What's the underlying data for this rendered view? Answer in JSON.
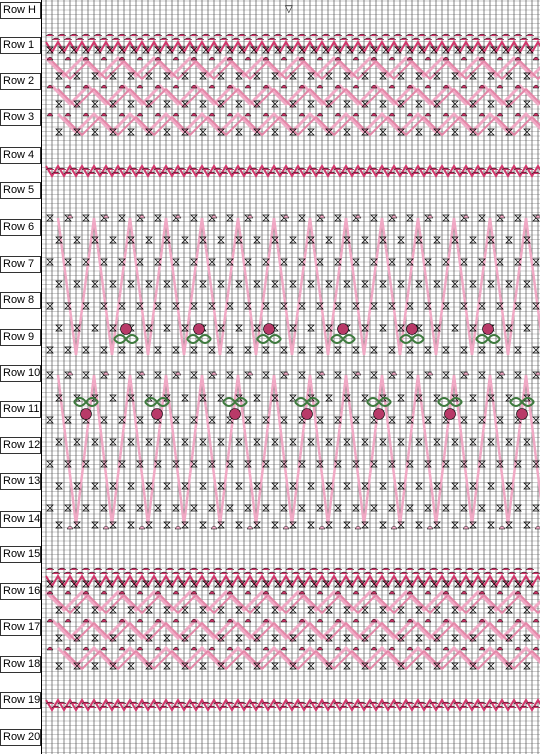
{
  "title": "",
  "row_labels": [
    "Row H",
    "Row 1",
    "Row 2",
    "Row 3",
    "Row 4",
    "Row 5",
    "Row 6",
    "Row 7",
    "Row 8",
    "Row 9",
    "Row 10",
    "Row 11",
    "Row 12",
    "Row 13",
    "Row 14",
    "Row 15",
    "Row 16",
    "Row 17",
    "Row 18",
    "Row 19",
    "Row 20"
  ],
  "center_marker": "▽",
  "colors": {
    "grid": "#9a9a9a",
    "pleat_line": "#555555",
    "dark_pink": "#d2386c",
    "light_pink": "#f0a8c4",
    "medium_pink": "#e487a8",
    "rose": "#b83a68",
    "leaf": "#3e7a3e",
    "stitch": "#000000"
  },
  "motifs": {
    "roses_row": "Row 9",
    "leaves_row": "Row 11"
  }
}
